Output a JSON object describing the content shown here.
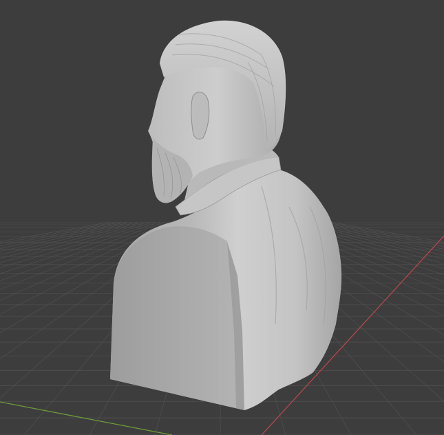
{
  "viewport": {
    "background_color": "#3d3d3d",
    "grid_color": "#545454",
    "x_axis_color": "#b5474f",
    "y_axis_color": "#6f9a3c",
    "model_color": "#c2c2c2",
    "model_shadow_color": "#8f8f8f"
  },
  "model": {
    "icon": "sculpted-bust-mesh"
  }
}
